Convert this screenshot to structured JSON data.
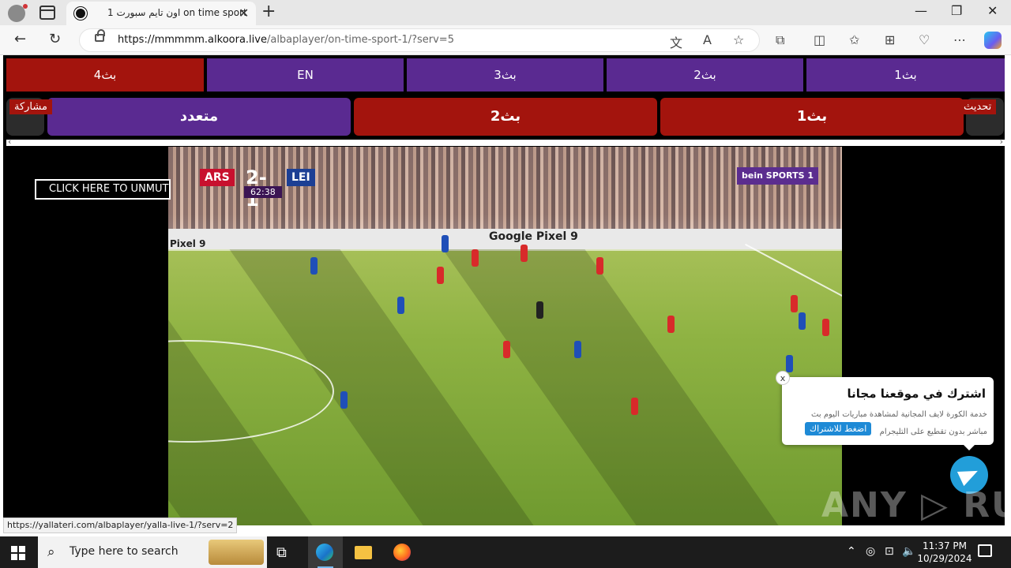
{
  "browser": {
    "tab_title": "اون تايم سبورت 1 on time sport",
    "url_host": "https://mmmmm.alkoora.live",
    "url_path": "/albaplayer/on-time-sport-1/?serv=5",
    "status_link": "https://yallateri.com/albaplayer/yalla-live-1/?serv=2"
  },
  "servers_row1": [
    "بث4",
    "EN",
    "بث3",
    "بث2",
    "بث1"
  ],
  "servers_row2": [
    "متعدد",
    "بث2",
    "بث1"
  ],
  "tags": {
    "share": "مشاركة",
    "refresh": "تحديث"
  },
  "video": {
    "home_team": "ARS",
    "away_team": "LEI",
    "score": "2-1",
    "match_time": "62:38",
    "channel": "bein SPORTS 1",
    "board_text": "Google Pixel 9",
    "board_text_left": "Pixel 9",
    "unmute_label": "CLICK HERE TO UNMUTE"
  },
  "popup": {
    "close": "x",
    "title": "اشترك في موقعنا مجانا",
    "desc": "خدمة الكورة لايف المجانية لمشاهدة مباريات اليوم بث مباشر بدون تقطيع على التليجرام",
    "button": "اضغط للاشتراك"
  },
  "watermark": "ANY ▷ RUN",
  "taskbar": {
    "search_placeholder": "Type here to search",
    "time": "11:37 PM",
    "date": "10/29/2024"
  },
  "colors": {
    "purple": "#5a2a91",
    "red": "#a3140d",
    "telegram": "#229ed9"
  }
}
